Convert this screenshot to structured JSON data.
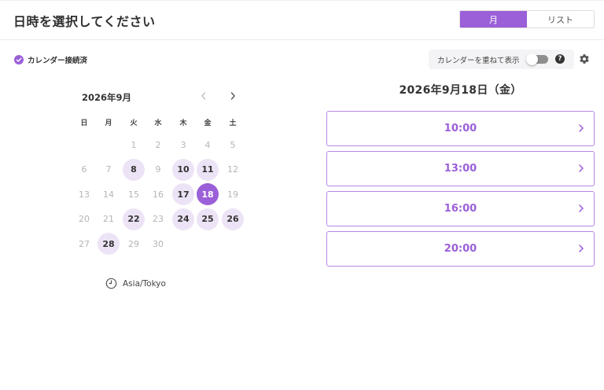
{
  "header": {
    "title": "日時を選択してください"
  },
  "view_toggle": {
    "month": "月",
    "list": "リスト",
    "active": "month"
  },
  "calendar_status": {
    "label": "カレンダー接続済"
  },
  "overlay": {
    "label": "カレンダーを重ねて表示",
    "enabled": false,
    "help": "?"
  },
  "calendar": {
    "month_label": "2026年9月",
    "weekdays": [
      "日",
      "月",
      "火",
      "水",
      "木",
      "金",
      "土"
    ],
    "first_weekday": 2,
    "days_in_month": 30,
    "available_days": [
      8,
      10,
      11,
      17,
      22,
      24,
      25,
      26,
      28
    ],
    "selected_day": 18
  },
  "timezone": {
    "label": "Asia/Tokyo"
  },
  "slots": {
    "heading": "2026年9月18日（金）",
    "times": [
      "10:00",
      "13:00",
      "16:00",
      "20:00"
    ]
  },
  "colors": {
    "accent": "#9b5fd8",
    "available_bg": "#ede3f6",
    "slot_border": "#b687e3"
  }
}
